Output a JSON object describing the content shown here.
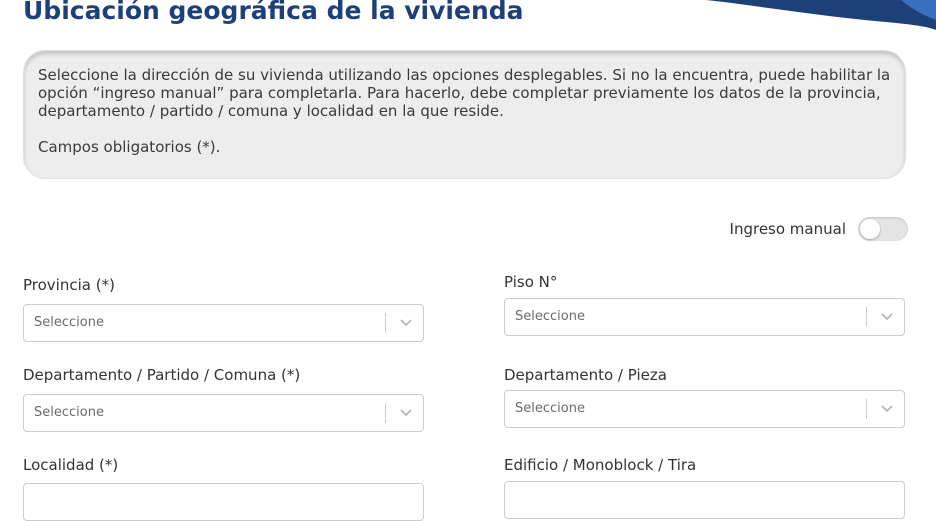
{
  "header": {
    "title": "Ubicación geográfica de la vivienda"
  },
  "info": {
    "paragraph1": "Seleccione la dirección de su vivienda utilizando las opciones desplegables. Si no la encuentra, puede habilitar la opción “ingreso manual” para completarla. Para hacerlo, debe completar previamente los datos de la provincia, departamento / partido / comuna y localidad en la que reside.",
    "paragraph2": "Campos obligatorios (*)."
  },
  "manual_entry": {
    "label": "Ingreso manual",
    "enabled": false
  },
  "fields": {
    "provincia": {
      "label": "Provincia (*)",
      "value": "Seleccione"
    },
    "departamento_partido": {
      "label": "Departamento / Partido / Comuna (*)",
      "value": "Seleccione"
    },
    "localidad": {
      "label": "Localidad (*)"
    },
    "piso": {
      "label": "Piso N°",
      "value": "Seleccione"
    },
    "departamento_pieza": {
      "label": "Departamento / Pieza",
      "value": "Seleccione"
    },
    "edificio": {
      "label": "Edificio / Monoblock / Tira"
    }
  },
  "icons": {
    "dropdown": "chevron-down-icon"
  },
  "colors": {
    "title": "#1e4079",
    "decoration": "#1e4079",
    "info_background": "#ededed"
  }
}
